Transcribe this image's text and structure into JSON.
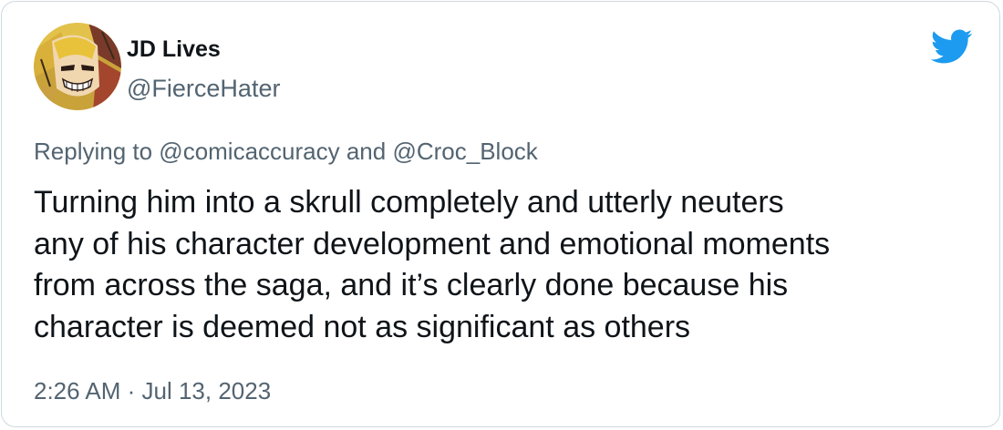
{
  "tweet": {
    "display_name": "JD Lives",
    "handle": "@FierceHater",
    "replying_to": "Replying to @comicaccuracy and @Croc_Block",
    "text_lines": [
      "Turning him into a skrull completely and utterly neuters",
      "any of his character development and emotional moments",
      "from across the saga, and it’s clearly done because his",
      "character is deemed not as significant as others"
    ],
    "timestamp": "2:26 AM · Jul 13, 2023"
  },
  "icons": {
    "brand_logo": "twitter-bird-icon",
    "avatar": "comic-character-avatar"
  },
  "colors": {
    "brand_blue": "#1d9bf0",
    "text_primary": "#0f1419",
    "text_secondary": "#536471",
    "border": "#cfd9de"
  }
}
